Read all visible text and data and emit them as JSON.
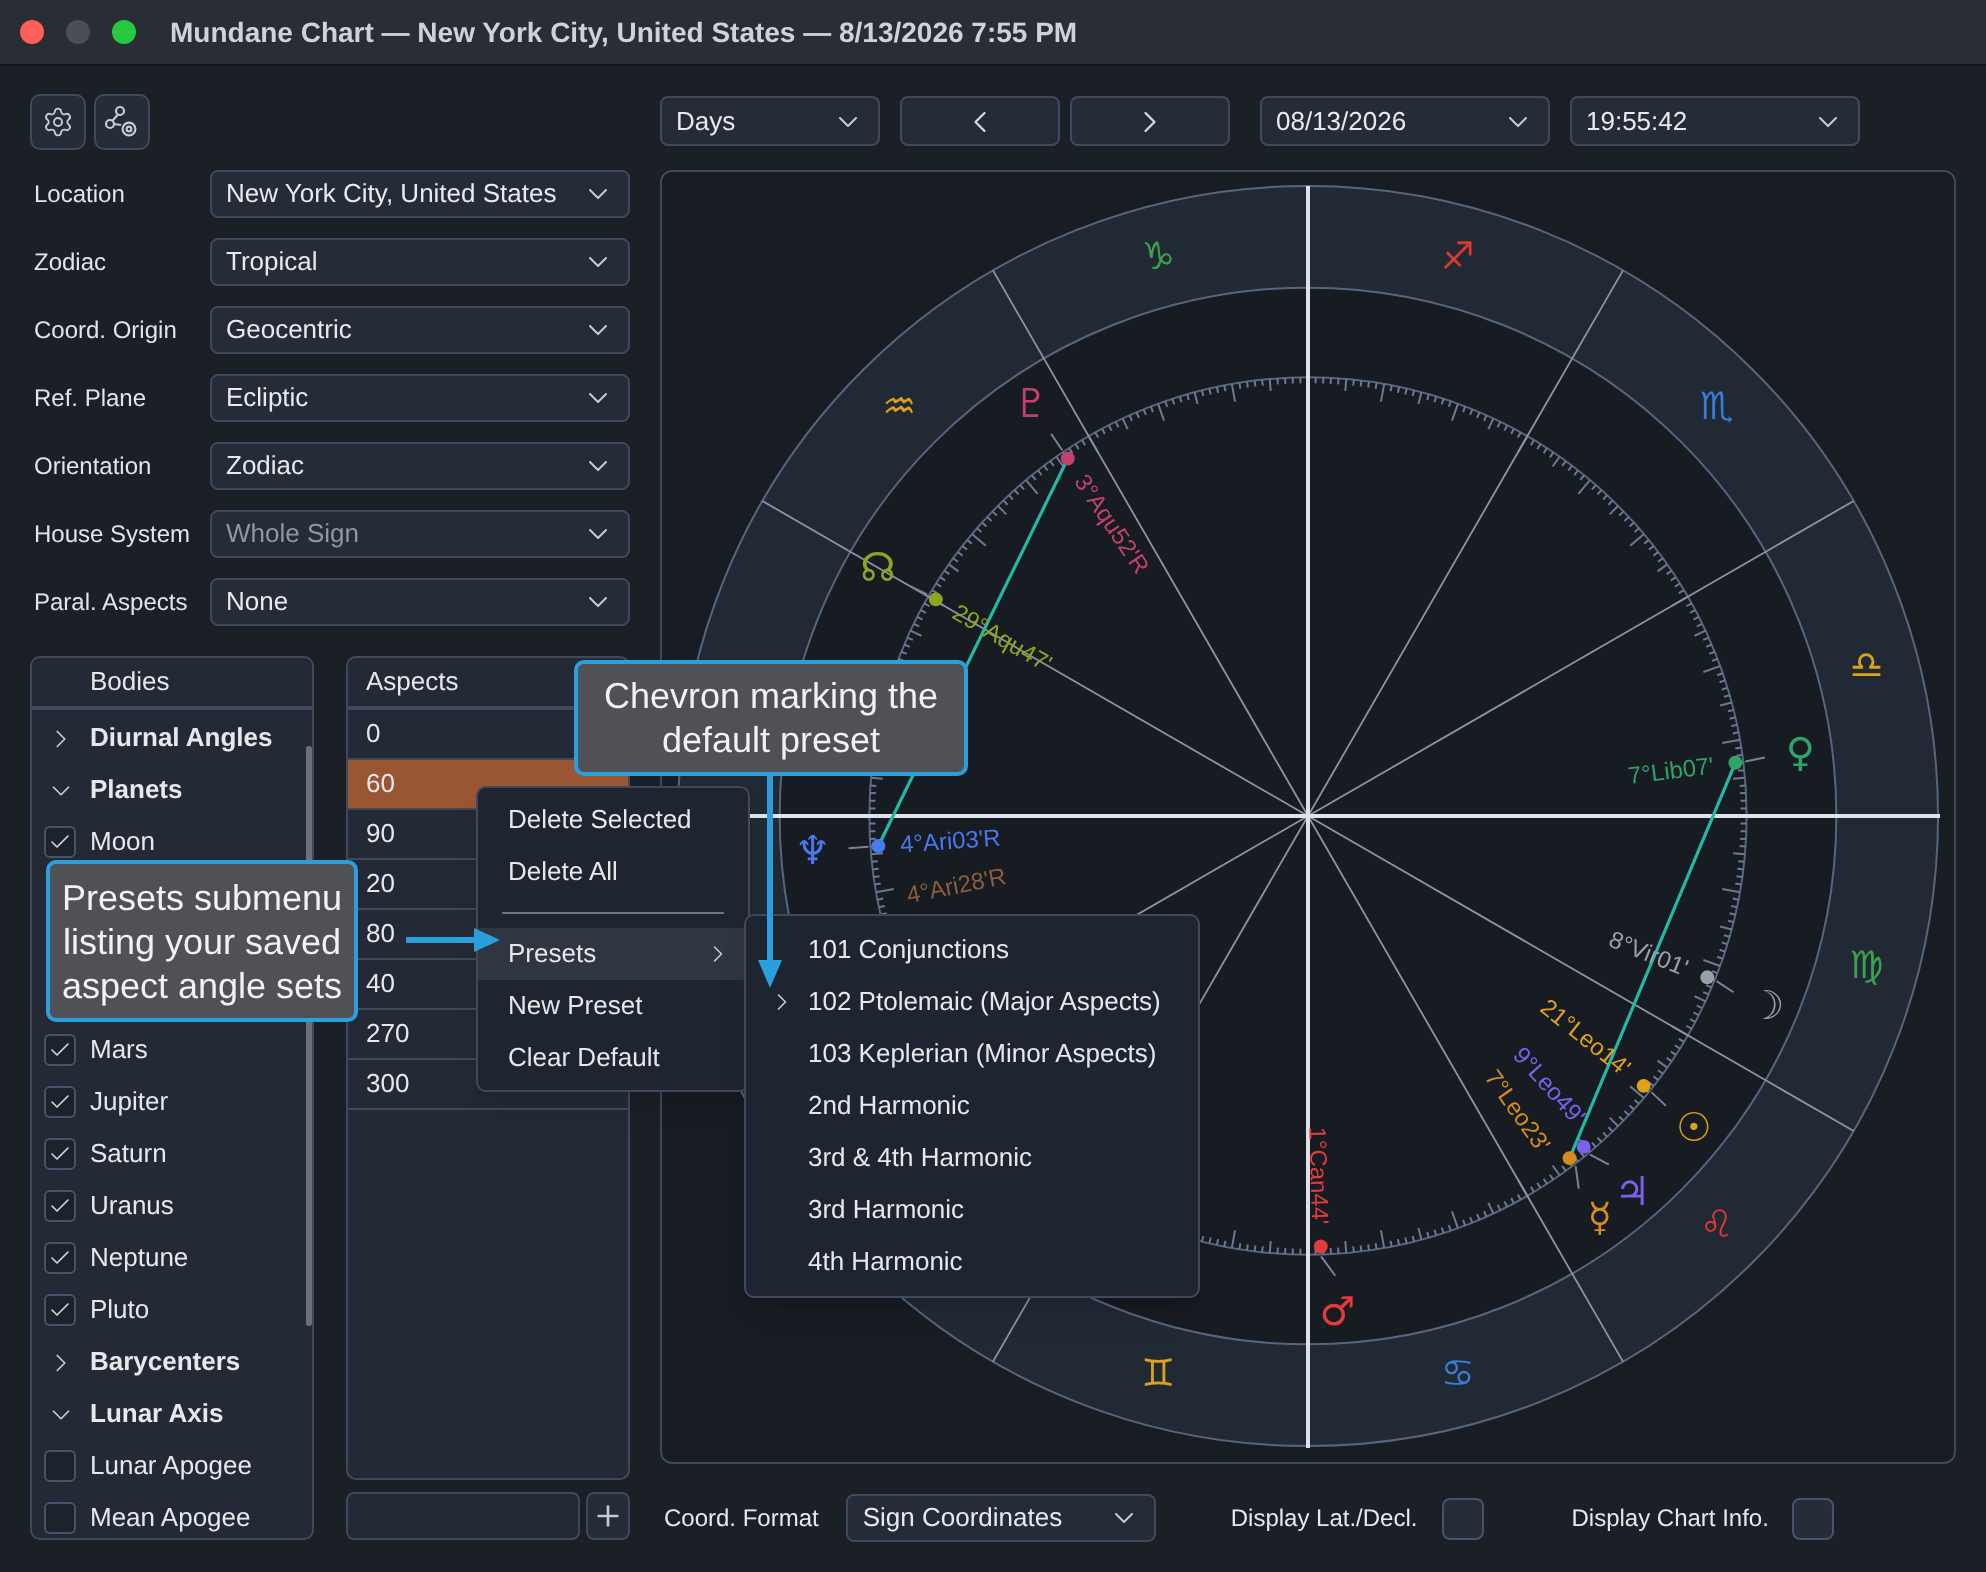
{
  "window": {
    "title": "Mundane Chart — New York City, United States — 8/13/2026 7:55 PM"
  },
  "traffic_lights": [
    {
      "color": "#ff5f57"
    },
    {
      "color": "#4b4e54"
    },
    {
      "color": "#28c840"
    }
  ],
  "toolbar": {
    "interval": "Days",
    "date": "08/13/2026",
    "time": "19:55:42"
  },
  "settings": [
    {
      "label": "Location",
      "value": "New York City, United States",
      "disabled": false
    },
    {
      "label": "Zodiac",
      "value": "Tropical",
      "disabled": false
    },
    {
      "label": "Coord. Origin",
      "value": "Geocentric",
      "disabled": false
    },
    {
      "label": "Ref. Plane",
      "value": "Ecliptic",
      "disabled": false
    },
    {
      "label": "Orientation",
      "value": "Zodiac",
      "disabled": false
    },
    {
      "label": "House System",
      "value": "Whole Sign",
      "disabled": true
    },
    {
      "label": "Paral. Aspects",
      "value": "None",
      "disabled": false
    }
  ],
  "bodies": {
    "header": "Bodies",
    "items": [
      {
        "kind": "group",
        "label": "Diurnal Angles",
        "expanded": false
      },
      {
        "kind": "group",
        "label": "Planets",
        "expanded": true
      },
      {
        "kind": "checkbox",
        "label": "Moon",
        "checked": true
      },
      {
        "kind": "covered"
      },
      {
        "kind": "covered"
      },
      {
        "kind": "covered"
      },
      {
        "kind": "checkbox",
        "label": "Mars",
        "checked": true
      },
      {
        "kind": "checkbox",
        "label": "Jupiter",
        "checked": true
      },
      {
        "kind": "checkbox",
        "label": "Saturn",
        "checked": true
      },
      {
        "kind": "checkbox",
        "label": "Uranus",
        "checked": true
      },
      {
        "kind": "checkbox",
        "label": "Neptune",
        "checked": true
      },
      {
        "kind": "checkbox",
        "label": "Pluto",
        "checked": true
      },
      {
        "kind": "group",
        "label": "Barycenters",
        "expanded": false
      },
      {
        "kind": "group",
        "label": "Lunar Axis",
        "expanded": true
      },
      {
        "kind": "checkbox",
        "label": "Lunar Apogee",
        "checked": false
      },
      {
        "kind": "checkbox",
        "label": "Mean Apogee",
        "checked": false
      }
    ]
  },
  "aspects": {
    "header": "Aspects",
    "rows": [
      {
        "value": "0",
        "selected": false
      },
      {
        "value": "60",
        "selected": true
      },
      {
        "value": "90",
        "selected": false
      },
      {
        "value": "20",
        "selected": false
      },
      {
        "value": "80",
        "selected": false
      },
      {
        "value": "40",
        "selected": false
      },
      {
        "value": "270",
        "selected": false
      },
      {
        "value": "300",
        "selected": false
      }
    ]
  },
  "context_menu": {
    "items": [
      {
        "kind": "item",
        "label": "Delete Selected",
        "selected": false
      },
      {
        "kind": "item",
        "label": "Delete All",
        "selected": false
      },
      {
        "kind": "separator"
      },
      {
        "kind": "submenu",
        "label": "Presets",
        "selected": true
      },
      {
        "kind": "item",
        "label": "New Preset",
        "selected": false
      },
      {
        "kind": "item",
        "label": "Clear Default",
        "selected": false
      }
    ]
  },
  "presets_submenu": {
    "items": [
      {
        "label": "101 Conjunctions",
        "default": false
      },
      {
        "label": "102 Ptolemaic (Major Aspects)",
        "default": true
      },
      {
        "label": "103 Keplerian (Minor Aspects)",
        "default": false
      },
      {
        "label": "2nd Harmonic",
        "default": false
      },
      {
        "label": "3rd & 4th Harmonic",
        "default": false
      },
      {
        "label": "3rd Harmonic",
        "default": false
      },
      {
        "label": "4th Harmonic",
        "default": false
      }
    ]
  },
  "callouts": [
    {
      "text": "Chevron marking the default preset"
    },
    {
      "text": "Presets submenu listing your saved aspect angle sets"
    }
  ],
  "chart": {
    "signs": [
      {
        "glyph": "♒",
        "color": "#d9a21b"
      },
      {
        "glyph": "♑",
        "color": "#3aa24a"
      },
      {
        "glyph": "♐",
        "color": "#d8392f"
      },
      {
        "glyph": "♏",
        "color": "#3a7bd5"
      },
      {
        "glyph": "♎",
        "color": "#d9a21b"
      },
      {
        "glyph": "♍",
        "color": "#3aa24a"
      },
      {
        "glyph": "♌",
        "color": "#d8392f"
      },
      {
        "glyph": "♋",
        "color": "#3a7bd5"
      },
      {
        "glyph": "♊",
        "color": "#d9a21b"
      }
    ],
    "planets": [
      {
        "glyph": "♇",
        "label": "3°Aqu52'R",
        "color": "#c4416f"
      },
      {
        "glyph": "☊",
        "label": "29°Aqu47'",
        "color": "#8ea51d"
      },
      {
        "glyph": "♆",
        "label": "4°Ari03'R",
        "color": "#4a78ee"
      },
      {
        "label": "4°Ari28'R",
        "color": "#8c5c3c"
      },
      {
        "glyph": "♀",
        "label": "7°Lib07'",
        "color": "#2fa368"
      },
      {
        "glyph": "☽",
        "label": "8°Vir01'",
        "color": "#9aa0a8"
      },
      {
        "glyph": "☉",
        "label": "21°Leo14'",
        "color": "#e0a018"
      },
      {
        "glyph": "♃",
        "label": "9°Leo49'",
        "color": "#7b61e8"
      },
      {
        "glyph": "☿",
        "label": "7°Leo23'",
        "color": "#d68b1e"
      },
      {
        "glyph": "♂",
        "label": "1°Can44'",
        "color": "#e23b3b"
      }
    ]
  },
  "bottom_bar": {
    "coord_format_label": "Coord. Format",
    "coord_format": "Sign Coordinates",
    "lat_decl_label": "Display Lat./Decl.",
    "lat_decl_checked": false,
    "chart_info_label": "Display Chart Info.",
    "chart_info_checked": false
  }
}
